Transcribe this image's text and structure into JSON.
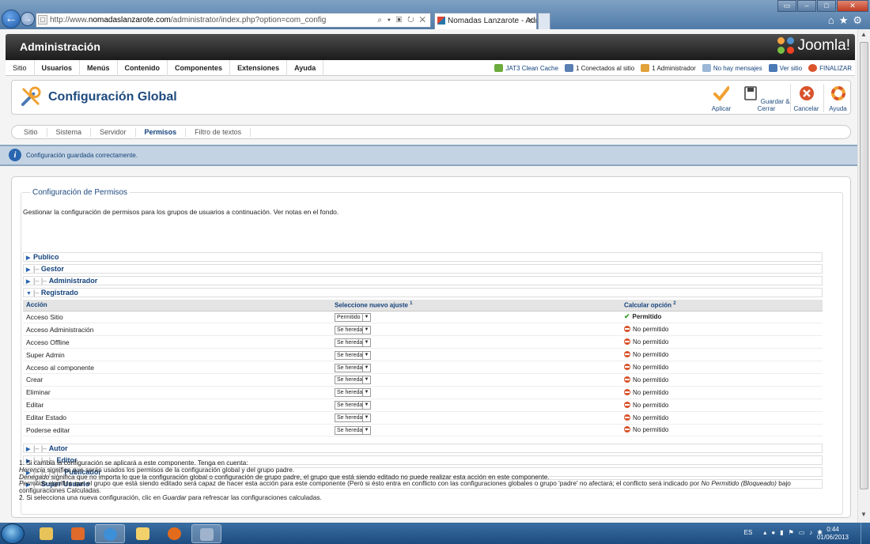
{
  "browser": {
    "url_prefix": "http://www.",
    "url_domain": "nomadaslanzarote.com",
    "url_path": "/administrator/index.php?option=com_config",
    "tab_title": "Nomadas Lanzarote - Admi...",
    "back_icon": "arrow-left-icon",
    "forward_icon": "arrow-right-icon"
  },
  "header": {
    "title": "Administración",
    "logo_text": "Joomla!"
  },
  "menu": {
    "items": [
      "Sitio",
      "Usuarios",
      "Menús",
      "Contenido",
      "Componentes",
      "Extensiones",
      "Ayuda"
    ],
    "status": {
      "cache": "JAT3 Clean Cache",
      "online": "1 Conectados al sitio",
      "admins": "1 Administrador",
      "messages": "No hay mensajes",
      "view_site": "Ver sitio",
      "logout": "FINALIZAR"
    }
  },
  "toolbar": {
    "title": "Configuración Global",
    "apply": "Aplicar",
    "save_close": "Guardar & Cerrar",
    "cancel": "Cancelar",
    "help": "Ayuda"
  },
  "subnav": {
    "tabs": [
      "Sitio",
      "Sistema",
      "Servidor",
      "Permisos",
      "Filtro de textos"
    ],
    "active": "Permisos"
  },
  "message": "Configuración guardada correctamente.",
  "permissions": {
    "legend": "Configuración de Permisos",
    "description": "Gestionar la configuración de permisos para los grupos de usuarios a continuación. Ver notas en el fondo.",
    "groups_before": [
      {
        "prefix": "",
        "name": "Publico"
      },
      {
        "prefix": "|– ",
        "name": "Gestor"
      },
      {
        "prefix": "|– |– ",
        "name": "Administrador"
      },
      {
        "prefix": "|– ",
        "name": "Registrado"
      }
    ],
    "columns": {
      "action": "Acción",
      "select": "Seleccione nuevo ajuste",
      "select_sup": "1",
      "calc": "Calcular opción",
      "calc_sup": "2"
    },
    "rows": [
      {
        "action": "Acceso Sitio",
        "setting": "Permitido",
        "calc": "Permitido",
        "allowed": true
      },
      {
        "action": "Acceso Administración",
        "setting": "Se hereda",
        "calc": "No permitido",
        "allowed": false
      },
      {
        "action": "Acceso Offline",
        "setting": "Se hereda",
        "calc": "No permitido",
        "allowed": false
      },
      {
        "action": "Super Admin",
        "setting": "Se hereda",
        "calc": "No permitido",
        "allowed": false
      },
      {
        "action": "Acceso al componente",
        "setting": "Se hereda",
        "calc": "No permitido",
        "allowed": false
      },
      {
        "action": "Crear",
        "setting": "Se hereda",
        "calc": "No permitido",
        "allowed": false
      },
      {
        "action": "Eliminar",
        "setting": "Se hereda",
        "calc": "No permitido",
        "allowed": false
      },
      {
        "action": "Editar",
        "setting": "Se hereda",
        "calc": "No permitido",
        "allowed": false
      },
      {
        "action": "Editar Estado",
        "setting": "Se hereda",
        "calc": "No permitido",
        "allowed": false
      },
      {
        "action": "Poderse editar",
        "setting": "Se hereda",
        "calc": "No permitido",
        "allowed": false
      }
    ],
    "groups_after": [
      {
        "prefix": "|– |– ",
        "name": "Autor"
      },
      {
        "prefix": "|– |– |– ",
        "name": "Editor"
      },
      {
        "prefix": "|– |– |– |– ",
        "name": "Publicador"
      },
      {
        "prefix": "|– ",
        "name": "Super Usuario"
      }
    ]
  },
  "notes": {
    "line1": "1. Si cambia la configuración se aplicará a este componente. Tenga en cuenta:",
    "herencia_term": "Herencia",
    "herencia_text": " significa que serán usados los permisos de la configuración global y del grupo padre.",
    "denegado_term": "Denegado",
    "denegado_text": " significa que no importa lo que la configuración global o configuración de grupo padre, el grupo que está siendo editado no puede realizar esta acción en este componente.",
    "permitido_term": "Permitido",
    "permitido_text": " significa que el grupo que está siendo editado será capaz de hacer esta acción para este componente (Però si ésto entra en conflicto con las configuraciones globales o grupo 'padre' no afectará; el conflicto será indicado por ",
    "permitido_em": "No Permitido (Bloqueado)",
    "permitido_tail": " bajo configuraciones Calculadas.",
    "line2_a": "2. Si selecciona una nueva configuración, clic en ",
    "line2_em": "Guardar",
    "line2_b": " para refrescar las configuraciones calculadas."
  },
  "taskbar": {
    "lang": "ES",
    "time": "0:44",
    "date": "01/06/2013"
  },
  "colors": {
    "accent": "#1e4a7f",
    "header_bg": "#1a1a1a",
    "message_bg": "#c3d3e3",
    "allowed": "#3a9e2e",
    "denied": "#d9532b"
  }
}
